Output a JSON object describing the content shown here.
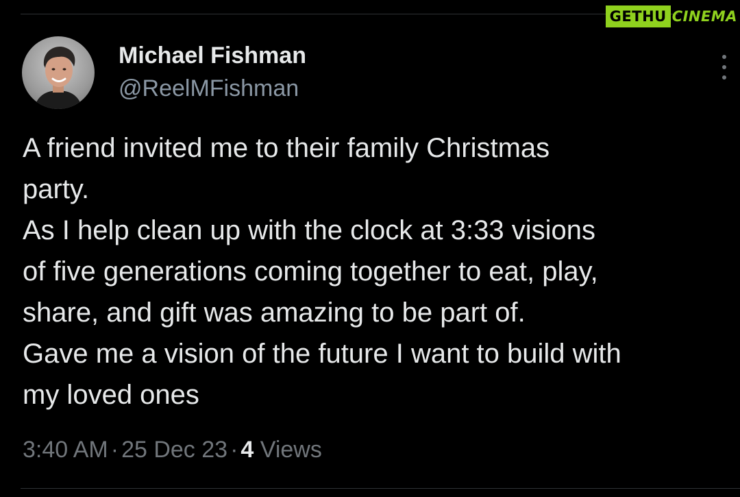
{
  "watermark": {
    "part1": "GETHU",
    "part2": "CINEMA"
  },
  "author": {
    "display_name": "Michael Fishman",
    "handle": "@ReelMFishman",
    "avatar_icon": "profile-photo"
  },
  "tweet": {
    "lines": [
      "A friend invited me to their family Christmas",
      "party.",
      "As I help clean up with the clock at 3:33 visions",
      "of five generations coming together to eat, play,",
      "share, and gift was amazing to be part of.",
      "Gave me a vision of the future I want to build with",
      "my loved ones"
    ]
  },
  "meta": {
    "time": "3:40 AM",
    "separator": "·",
    "date": "25 Dec 23",
    "views_count": "4",
    "views_label": "Views"
  },
  "more_icon": "more-vertical-icon",
  "colors": {
    "background": "#000000",
    "primary_text": "#e7e9ea",
    "secondary_text": "#71767b",
    "watermark_green": "#8fd11e"
  }
}
